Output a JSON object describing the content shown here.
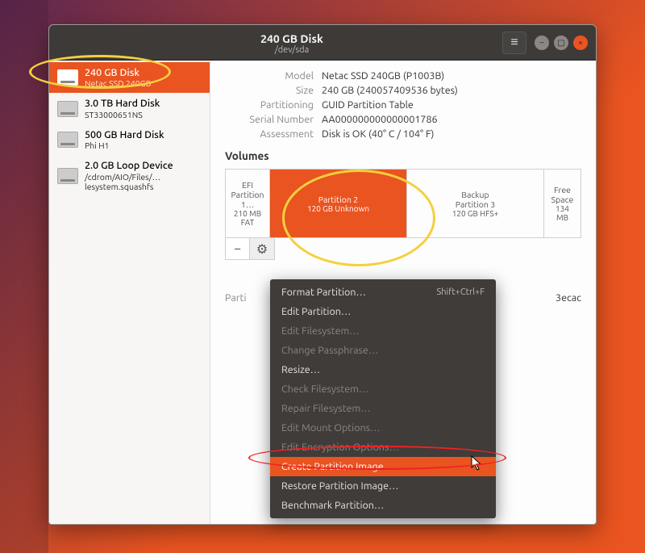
{
  "window": {
    "title": "240 GB Disk",
    "subtitle": "/dev/sda"
  },
  "sidebar": {
    "devices": [
      {
        "title": "240 GB Disk",
        "sub": "Netac SSD 240GB",
        "selected": true
      },
      {
        "title": "3.0 TB Hard Disk",
        "sub": "ST33000651NS",
        "selected": false
      },
      {
        "title": "500 GB Hard Disk",
        "sub": "Phi H1",
        "selected": false
      },
      {
        "title": "2.0 GB Loop Device",
        "sub": "/cdrom/AIO/Files/…lesystem.squashfs",
        "selected": false
      }
    ]
  },
  "details": {
    "model_k": "Model",
    "model_v": "Netac SSD 240GB (P1003B)",
    "size_k": "Size",
    "size_v": "240 GB (240057409536 bytes)",
    "part_k": "Partitioning",
    "part_v": "GUID Partition Table",
    "serial_k": "Serial Number",
    "serial_v": "AA000000000000001786",
    "assess_k": "Assessment",
    "assess_v": "Disk is OK (40° C / 104° F)"
  },
  "volumes": {
    "heading": "Volumes",
    "items": [
      {
        "name": "EFI",
        "line2": "Partition 1…",
        "size": "210 MB FAT"
      },
      {
        "name": "Partition 2",
        "line2": "120 GB Unknown",
        "size": ""
      },
      {
        "name": "Backup",
        "line2": "Partition 3",
        "size": "120 GB HFS+"
      },
      {
        "name": "Free Space",
        "line2": "134 MB",
        "size": ""
      }
    ],
    "toolbar": {
      "minus": "−",
      "gear": "⚙"
    }
  },
  "partition_row": {
    "label": "Parti",
    "tail": "3ecac"
  },
  "context_menu": {
    "items": [
      {
        "label": "Format Partition…",
        "shortcut": "Shift+Ctrl+F",
        "disabled": false,
        "hover": false
      },
      {
        "label": "Edit Partition…",
        "shortcut": "",
        "disabled": false,
        "hover": false
      },
      {
        "label": "Edit Filesystem…",
        "shortcut": "",
        "disabled": true,
        "hover": false
      },
      {
        "label": "Change Passphrase…",
        "shortcut": "",
        "disabled": true,
        "hover": false
      },
      {
        "label": "Resize…",
        "shortcut": "",
        "disabled": false,
        "hover": false
      },
      {
        "label": "Check Filesystem…",
        "shortcut": "",
        "disabled": true,
        "hover": false
      },
      {
        "label": "Repair Filesystem…",
        "shortcut": "",
        "disabled": true,
        "hover": false
      },
      {
        "label": "Edit Mount Options…",
        "shortcut": "",
        "disabled": true,
        "hover": false
      },
      {
        "label": "Edit Encryption Options…",
        "shortcut": "",
        "disabled": true,
        "hover": false
      },
      {
        "label": "Create Partition Image…",
        "shortcut": "",
        "disabled": false,
        "hover": true
      },
      {
        "label": "Restore Partition Image…",
        "shortcut": "",
        "disabled": false,
        "hover": false
      },
      {
        "label": "Benchmark Partition…",
        "shortcut": "",
        "disabled": false,
        "hover": false
      }
    ]
  }
}
